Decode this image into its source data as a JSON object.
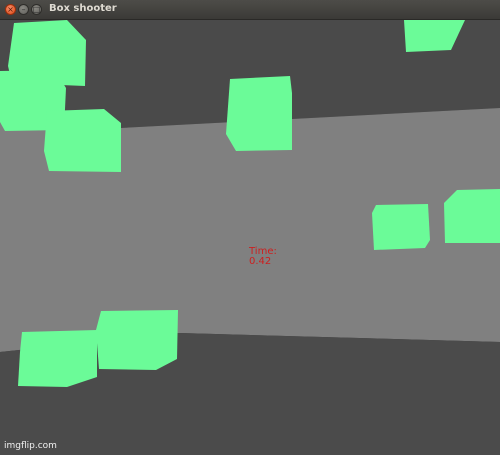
{
  "window": {
    "title": "Box shooter",
    "controls": {
      "close_glyph": "×",
      "minimize_glyph": "–",
      "maximize_glyph": "□"
    }
  },
  "hud": {
    "time_label": "Time:",
    "time_value": "0.42"
  },
  "watermark": "imgflip.com",
  "colors": {
    "box": "#6bfb98",
    "ceiling": "#4a4a4a",
    "back_wall": "#808080",
    "floor": "#4b4b4b",
    "timer_text": "#cc1f1f"
  }
}
